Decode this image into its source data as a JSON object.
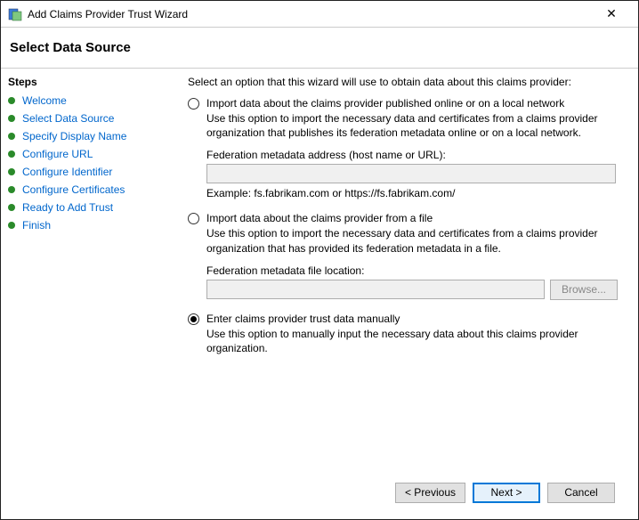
{
  "titlebar": {
    "title": "Add Claims Provider Trust Wizard"
  },
  "header": {
    "title": "Select Data Source"
  },
  "sidebar": {
    "steps_label": "Steps",
    "items": [
      {
        "label": "Welcome"
      },
      {
        "label": "Select Data Source"
      },
      {
        "label": "Specify Display Name"
      },
      {
        "label": "Configure URL"
      },
      {
        "label": "Configure Identifier"
      },
      {
        "label": "Configure Certificates"
      },
      {
        "label": "Ready to Add Trust"
      },
      {
        "label": "Finish"
      }
    ]
  },
  "content": {
    "intro": "Select an option that this wizard will use to obtain data about this claims provider:",
    "opt1": {
      "label": "Import data about the claims provider published online or on a local network",
      "desc": "Use this option to import the necessary data and certificates from a claims provider organization that publishes its federation metadata online or on a local network.",
      "field_label": "Federation metadata address (host name or URL):",
      "value": "",
      "hint": "Example: fs.fabrikam.com or https://fs.fabrikam.com/"
    },
    "opt2": {
      "label": "Import data about the claims provider from a file",
      "desc": "Use this option to import the necessary data and certificates from a claims provider organization that has provided its federation metadata in a file.",
      "field_label": "Federation metadata file location:",
      "value": "",
      "browse_label": "Browse..."
    },
    "opt3": {
      "label": "Enter claims provider trust data manually",
      "desc": "Use this option to manually input the necessary data about this claims provider organization."
    }
  },
  "footer": {
    "previous": "< Previous",
    "next": "Next >",
    "cancel": "Cancel"
  }
}
